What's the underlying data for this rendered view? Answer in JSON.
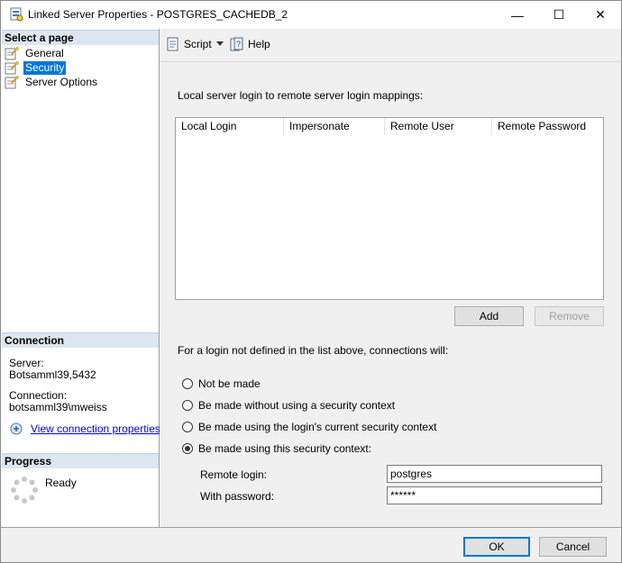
{
  "window": {
    "title": "Linked Server Properties - POSTGRES_CACHEDB_2",
    "controls": {
      "minimize": "—",
      "maximize": "☐",
      "close": "✕"
    }
  },
  "sidebar": {
    "select_page_heading": "Select a page",
    "pages": [
      {
        "label": "General",
        "icon": "wrench-page-icon",
        "selected": false
      },
      {
        "label": "Security",
        "icon": "wrench-page-icon",
        "selected": true
      },
      {
        "label": "Server Options",
        "icon": "wrench-page-icon",
        "selected": false
      }
    ],
    "connection": {
      "heading": "Connection",
      "server_label": "Server:",
      "server_value": "Botsamml39,5432",
      "connection_label": "Connection:",
      "connection_value": "botsamml39\\mweiss",
      "view_link": "View connection properties"
    },
    "progress": {
      "heading": "Progress",
      "status": "Ready"
    }
  },
  "toolbar": {
    "script_label": "Script",
    "help_label": "Help"
  },
  "main": {
    "mappings_label": "Local server login to remote server login mappings:",
    "columns": [
      "Local Login",
      "Impersonate",
      "Remote User",
      "Remote Password"
    ],
    "rows": [],
    "add_label": "Add",
    "remove_label": "Remove",
    "undefined_label": "For a login not defined in the list above, connections will:",
    "options": [
      {
        "label": "Not be made",
        "checked": false
      },
      {
        "label": "Be made without using a security context",
        "checked": false
      },
      {
        "label": "Be made using the login's current security context",
        "checked": false
      },
      {
        "label": "Be made using this security context:",
        "checked": true
      }
    ],
    "remote_login_label": "Remote login:",
    "remote_login_value": "postgres",
    "password_label": "With password:",
    "password_value": "******"
  },
  "footer": {
    "ok_label": "OK",
    "cancel_label": "Cancel"
  },
  "colors": {
    "selection": "#0078d7",
    "section_header": "#dce6f0",
    "link": "#0000ee"
  }
}
